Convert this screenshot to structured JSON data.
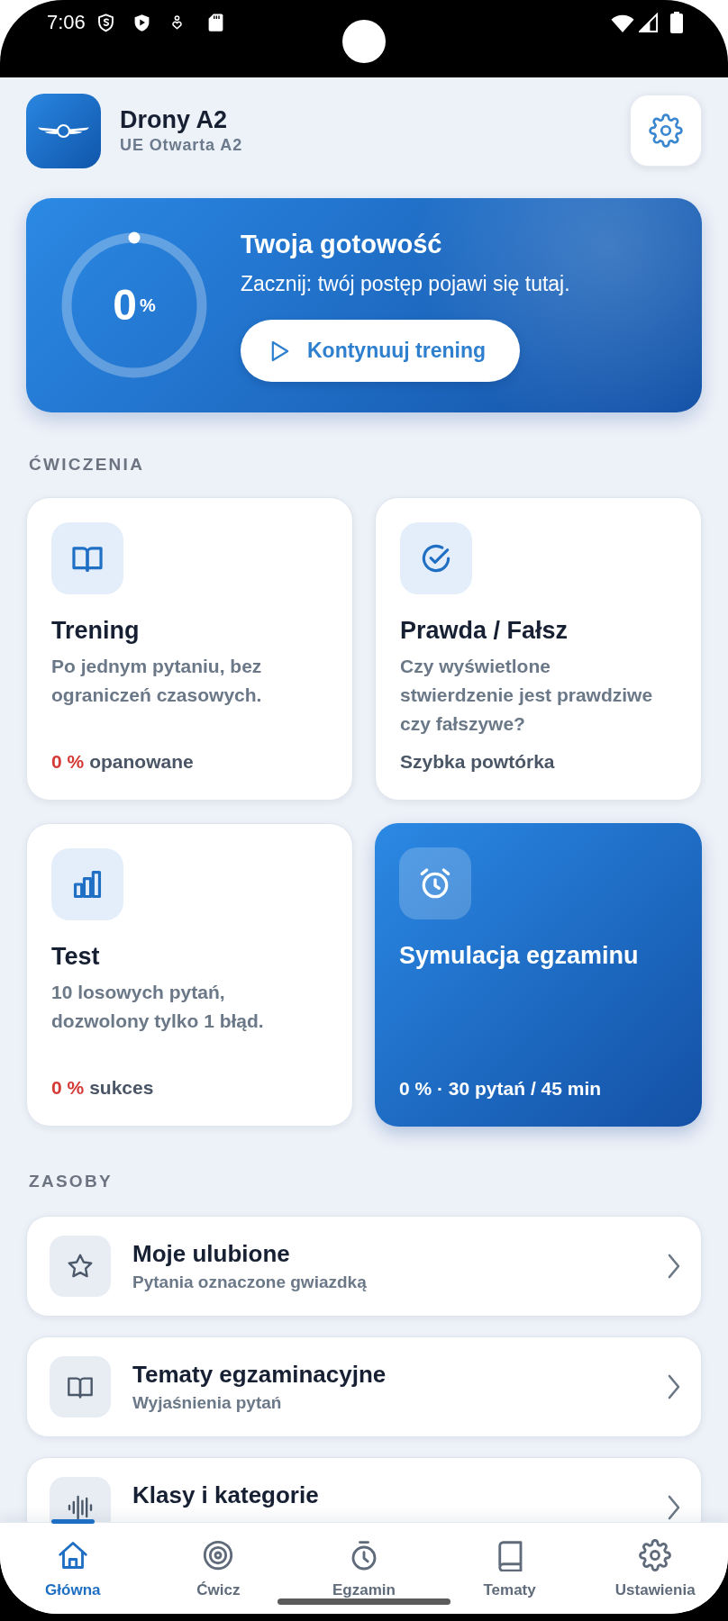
{
  "status_bar": {
    "time": "7:06"
  },
  "header": {
    "title": "Drony A2",
    "subtitle": "UE Otwarta A2"
  },
  "readiness": {
    "value": "0",
    "unit": "%",
    "title": "Twoja gotowość",
    "message": "Zacznij: twój postęp pojawi się tutaj.",
    "button": "Kontynuuj trening"
  },
  "exercises": {
    "heading": "ĆWICZENIA",
    "cards": [
      {
        "kind": "training",
        "featured": false,
        "title": "Trening",
        "description": "Po jednym pytaniu, bez ograniczeń czasowych.",
        "stat": "0 %",
        "footer": "opanowane"
      },
      {
        "kind": "true_false",
        "featured": false,
        "title": "Prawda / Fałsz",
        "description": "Czy wyświetlone stwierdzenie jest prawdziwe czy fałszywe?",
        "footer": "Szybka powtórka"
      },
      {
        "kind": "test",
        "featured": false,
        "title": "Test",
        "description": "10 losowych pytań, dozwolony tylko 1 błąd.",
        "stat": "0 %",
        "footer": "sukces"
      },
      {
        "kind": "exam",
        "featured": true,
        "title": "Symulacja egzaminu",
        "footer": "0 % · 30 pytań / 45 min"
      }
    ]
  },
  "resources": {
    "heading": "ZASOBY",
    "items": [
      {
        "kind": "favorites",
        "title": "Moje ulubione",
        "subtitle": "Pytania oznaczone gwiazdką"
      },
      {
        "kind": "topics",
        "title": "Tematy egzaminacyjne",
        "subtitle": "Wyjaśnienia pytań"
      },
      {
        "kind": "classes",
        "title": "Klasy i kategorie"
      }
    ]
  },
  "bottom_nav": {
    "tabs": [
      {
        "kind": "home",
        "label": "Główna",
        "selected": true
      },
      {
        "kind": "practice",
        "label": "Ćwicz",
        "selected": false
      },
      {
        "kind": "exam",
        "label": "Egzamin",
        "selected": false
      },
      {
        "kind": "topics",
        "label": "Tematy",
        "selected": false
      },
      {
        "kind": "settings",
        "label": "Ustawienia",
        "selected": false
      }
    ]
  }
}
